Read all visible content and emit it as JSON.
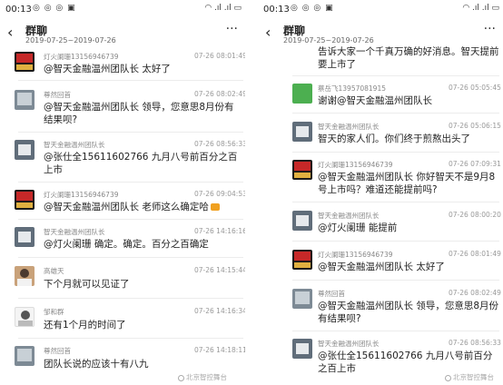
{
  "status_bar": {
    "time": "00:13",
    "apps": "◎ ◎ ◎ ▣",
    "indicators": "◠ .ıl .ıl ▭"
  },
  "header": {
    "back": "‹",
    "title": "群聊",
    "date_range": "2019-07-25~2019-07-26",
    "more": "···"
  },
  "left": [
    {
      "name": "灯火阑珊13156946739",
      "time": "07-26 08:01:49",
      "text": "@智天金融温州团队长 太好了"
    },
    {
      "name": "尊然回首",
      "time": "07-26 08:02:49",
      "text": "@智天金融温州团队长 领导，您意思8月份有结果呗?"
    },
    {
      "name": "智天金融温州团队长",
      "time": "07-26 08:56:33",
      "text": "@张仕全15611602766 九月八号前百分之百上市"
    },
    {
      "name": "灯火阑珊13156946739",
      "time": "07-26 09:04:53",
      "text": "@智天金融温州团队长 老师这么确定哈"
    },
    {
      "name": "智天金融温州团队长",
      "time": "07-26 14:16:16",
      "text": "@灯火阑珊 确定。确定。百分之百确定"
    },
    {
      "name": "高雄天",
      "time": "07-26 14:15:44",
      "text": "下个月就可以见证了"
    },
    {
      "name": "邹和群",
      "time": "07-26 14:16:34",
      "text": "还有1个月的时间了"
    },
    {
      "name": "尊然回首",
      "time": "07-26 14:18:11",
      "text": "团队长说的应该十有八九"
    }
  ],
  "right": [
    {
      "text": "告诉大家一个千真万确的好消息。智天提前要上市了"
    },
    {
      "name": "蔡岳飞13957081915",
      "time": "07-26 05:05:45",
      "text": "谢谢@智天金融温州团队长"
    },
    {
      "name": "智天金融温州团队长",
      "time": "07-26 05:06:15",
      "text": "智天的家人们。你们终于煎熬出头了"
    },
    {
      "name": "灯火阑珊13156946739",
      "time": "07-26 07:09:31",
      "text": "@智天金融温州团队长 你好智天不是9月8号上市吗？难道还能提前吗?"
    },
    {
      "name": "智天金融温州团队长",
      "time": "07-26 08:00:20",
      "text": "@灯火阑珊 能提前"
    },
    {
      "name": "灯火阑珊13156946739",
      "time": "07-26 08:01:49",
      "text": "@智天金融温州团队长 太好了"
    },
    {
      "name": "尊然回首",
      "time": "07-26 08:02:49",
      "text": "@智天金融温州团队长 领导，您意思8月份有结果呗?"
    },
    {
      "name": "智天金融温州团队长",
      "time": "07-26 08:56:33",
      "text": "@张仕全15611602766 九月八号前百分之百上市"
    }
  ],
  "watermark": "北京智控舞台"
}
